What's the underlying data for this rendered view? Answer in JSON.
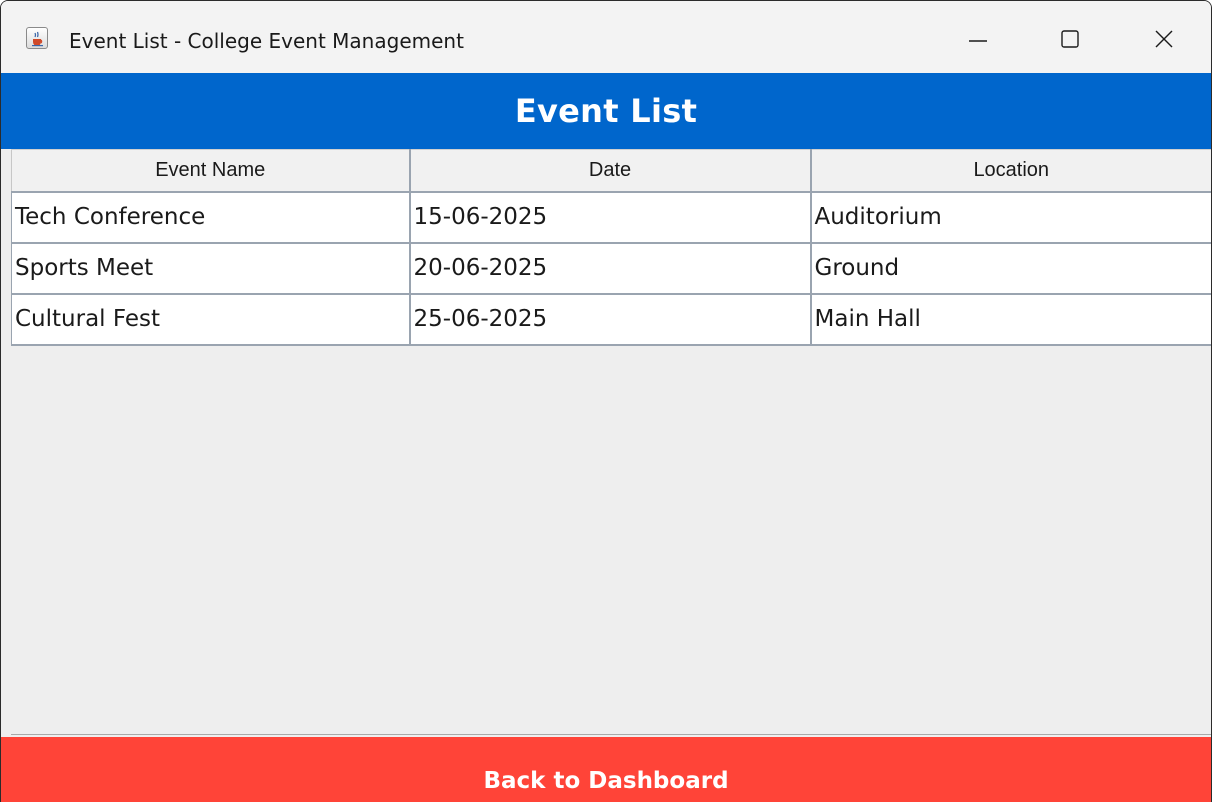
{
  "window": {
    "title": "Event List - College Event Management",
    "app_icon": "java-cup-icon",
    "controls": [
      "minimize-icon",
      "maximize-icon",
      "close-icon"
    ]
  },
  "banner": {
    "title": "Event List",
    "color": "#0066cc"
  },
  "table": {
    "columns": [
      "Event Name",
      "Date",
      "Location"
    ],
    "rows": [
      [
        "Tech Conference",
        "15-06-2025",
        "Auditorium"
      ],
      [
        "Sports Meet",
        "20-06-2025",
        "Ground"
      ],
      [
        "Cultural Fest",
        "25-06-2025",
        "Main Hall"
      ]
    ]
  },
  "footer": {
    "back_label": "Back to Dashboard",
    "color": "#ff4438"
  }
}
